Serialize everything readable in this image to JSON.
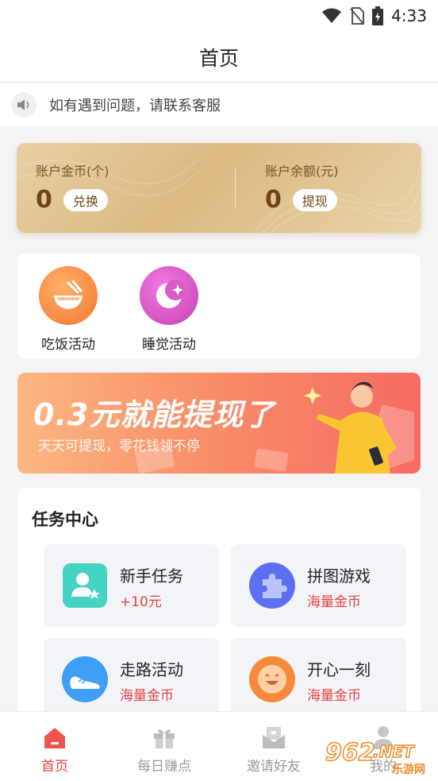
{
  "status_bar": {
    "time": "4:33"
  },
  "header": {
    "title": "首页"
  },
  "notice": {
    "text": "如有遇到问题，请联系客服"
  },
  "account": {
    "coins_label": "账户金币(个)",
    "coins_value": "0",
    "exchange_label": "兑换",
    "balance_label": "账户余额(元)",
    "balance_value": "0",
    "withdraw_label": "提现"
  },
  "activities": [
    {
      "label": "吃饭活动",
      "icon": "rice-bowl-icon",
      "color": "#f77c3a"
    },
    {
      "label": "睡觉活动",
      "icon": "moon-icon",
      "color": "#d94fc2"
    }
  ],
  "banner": {
    "headline": "0.3元就能提现了",
    "subtitle": "天天可提现，零花钱领不停"
  },
  "tasks": {
    "title": "任务中心",
    "items": [
      {
        "name": "新手任务",
        "reward": "+10元",
        "icon": "user-star-icon",
        "color": "#3fcdc0"
      },
      {
        "name": "拼图游戏",
        "reward": "海量金币",
        "icon": "puzzle-icon",
        "color": "#5a6ef0"
      },
      {
        "name": "走路活动",
        "reward": "海量金币",
        "icon": "shoe-icon",
        "color": "#3d9cf5"
      },
      {
        "name": "开心一刻",
        "reward": "海量金币",
        "icon": "smile-icon",
        "color": "#f7893a"
      }
    ]
  },
  "tabbar": {
    "items": [
      {
        "label": "首页",
        "icon": "home-icon",
        "active": true
      },
      {
        "label": "每日赚点",
        "icon": "gift-icon",
        "active": false
      },
      {
        "label": "邀请好友",
        "icon": "envelope-icon",
        "active": false
      },
      {
        "label": "我的",
        "icon": "person-icon",
        "active": false
      }
    ],
    "active_color": "#e4413f",
    "inactive_color": "#9a9a9a"
  },
  "watermark": {
    "number": "962",
    "net": ".NET",
    "site": "乐游网"
  }
}
